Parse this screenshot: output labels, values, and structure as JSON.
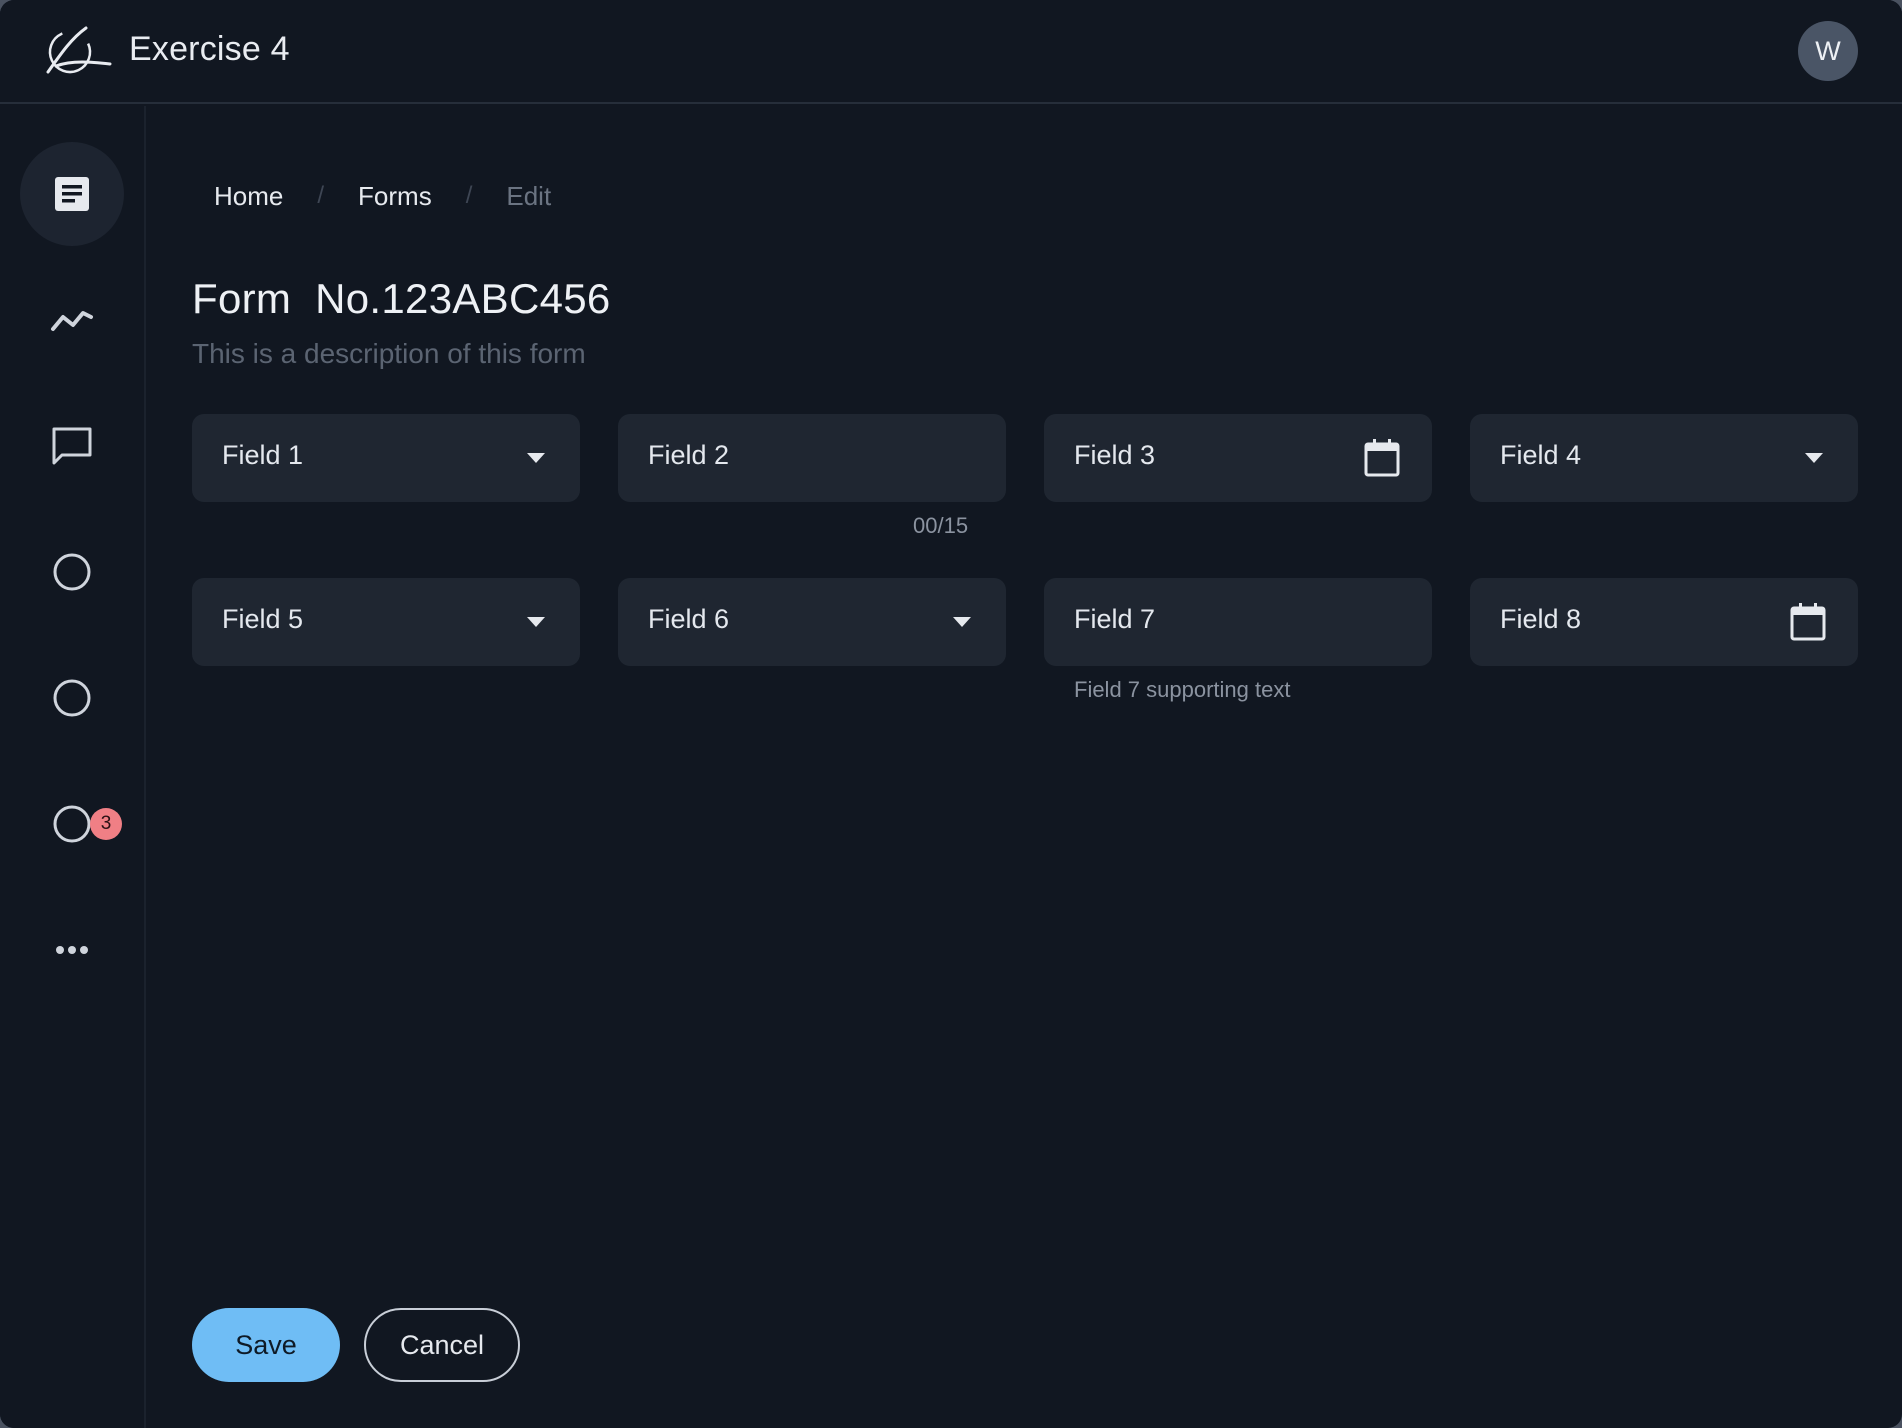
{
  "header": {
    "title": "Exercise 4",
    "avatar_initial": "W"
  },
  "sidebar": {
    "items": [
      {
        "icon": "document-icon",
        "active": true
      },
      {
        "icon": "trend-line-icon",
        "active": false
      },
      {
        "icon": "chat-icon",
        "active": false
      },
      {
        "icon": "circle-icon",
        "active": false
      },
      {
        "icon": "circle-icon",
        "active": false
      },
      {
        "icon": "circle-icon",
        "active": false,
        "badge": "3"
      },
      {
        "icon": "more-icon",
        "active": false
      }
    ]
  },
  "breadcrumb": {
    "home": "Home",
    "separator": "/",
    "forms": "Forms",
    "current": "Edit"
  },
  "form": {
    "title": "Form  No.123ABC456",
    "description": "This is a description of this form",
    "fields": [
      {
        "label": "Field 1",
        "type": "select"
      },
      {
        "label": "Field 2",
        "type": "text",
        "counter": "00/15"
      },
      {
        "label": "Field 3",
        "type": "date"
      },
      {
        "label": "Field 4",
        "type": "select"
      },
      {
        "label": "Field 5",
        "type": "select"
      },
      {
        "label": "Field 6",
        "type": "select"
      },
      {
        "label": "Field 7",
        "type": "text",
        "supporting_text": "Field 7 supporting text"
      },
      {
        "label": "Field 8",
        "type": "date"
      }
    ]
  },
  "actions": {
    "save": "Save",
    "cancel": "Cancel"
  },
  "colors": {
    "background": "#111721",
    "field_bg": "#1f2631",
    "primary": "#6fbdf5",
    "badge": "#f07f85"
  }
}
